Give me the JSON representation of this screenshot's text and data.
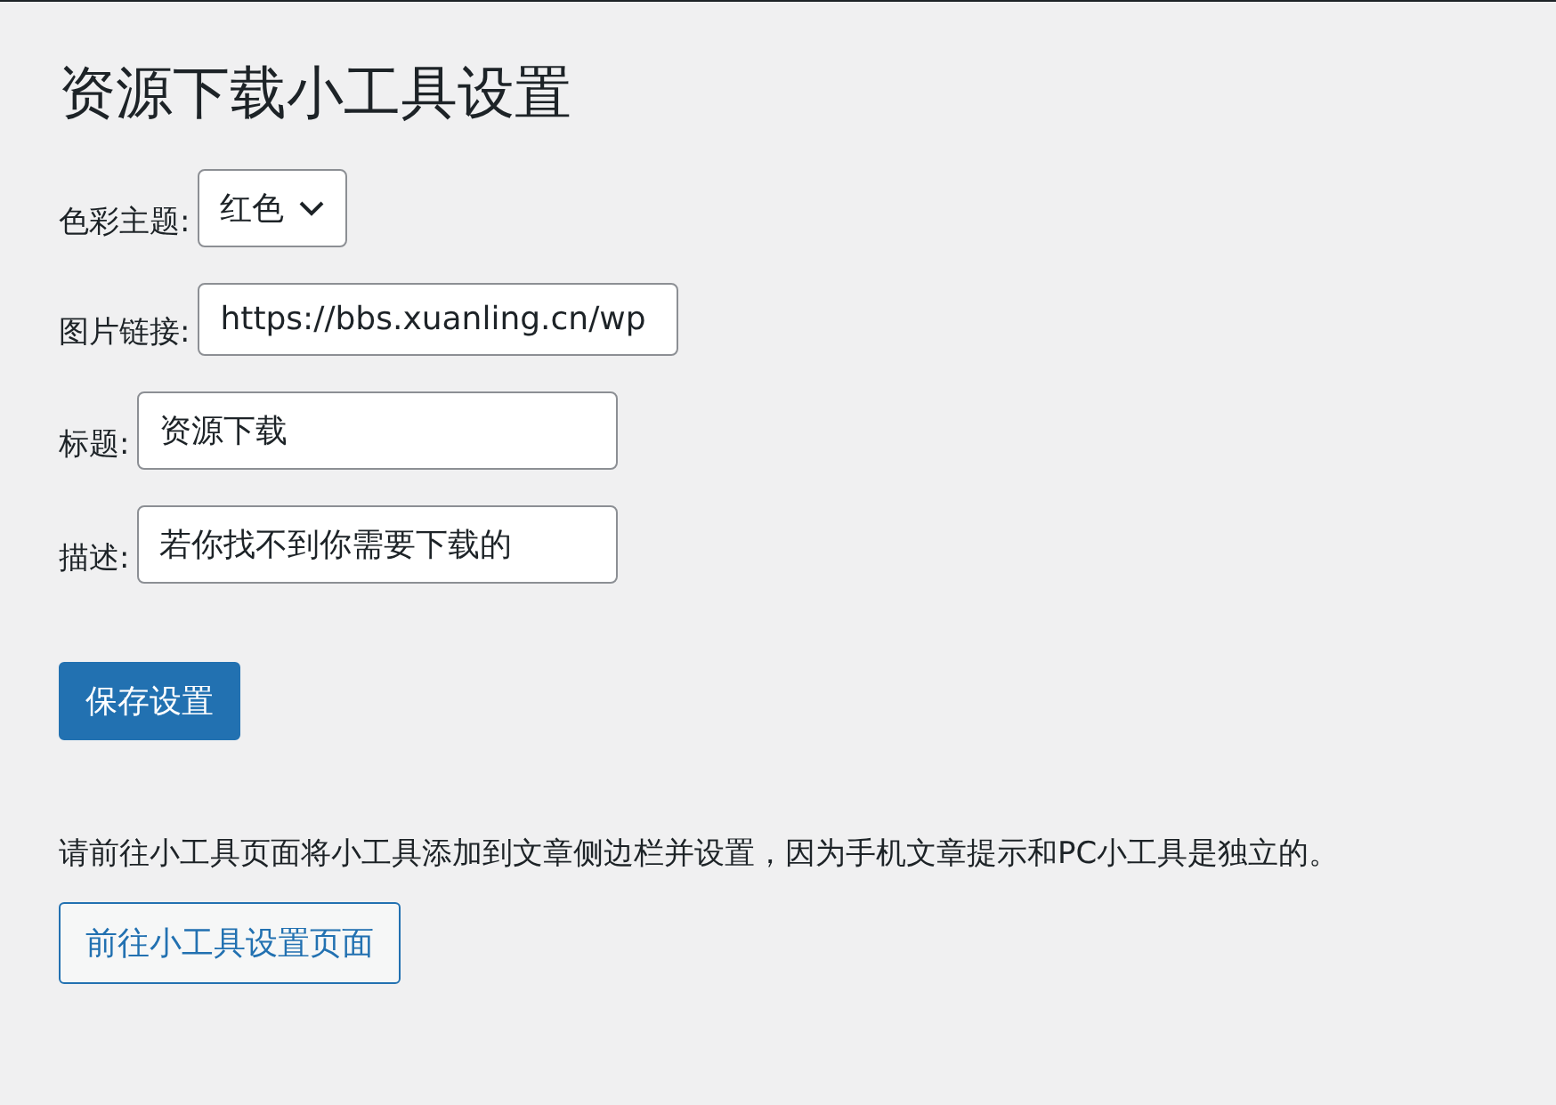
{
  "title": "资源下载小工具设置",
  "fields": [
    {
      "kind": "select",
      "label": "色彩主题:",
      "value": "红色"
    },
    {
      "kind": "text",
      "label": "图片链接:",
      "value": "https://bbs.xuanling.cn/wp"
    },
    {
      "kind": "text",
      "label": "标题:",
      "value": "资源下载"
    },
    {
      "kind": "text",
      "label": "描述:",
      "value": "若你找不到你需要下载的"
    }
  ],
  "save_button": "保存设置",
  "note": "请前往小工具页面将小工具添加到文章侧边栏并设置，因为手机文章提示和PC小工具是独立的。",
  "link_button": "前往小工具设置页面"
}
